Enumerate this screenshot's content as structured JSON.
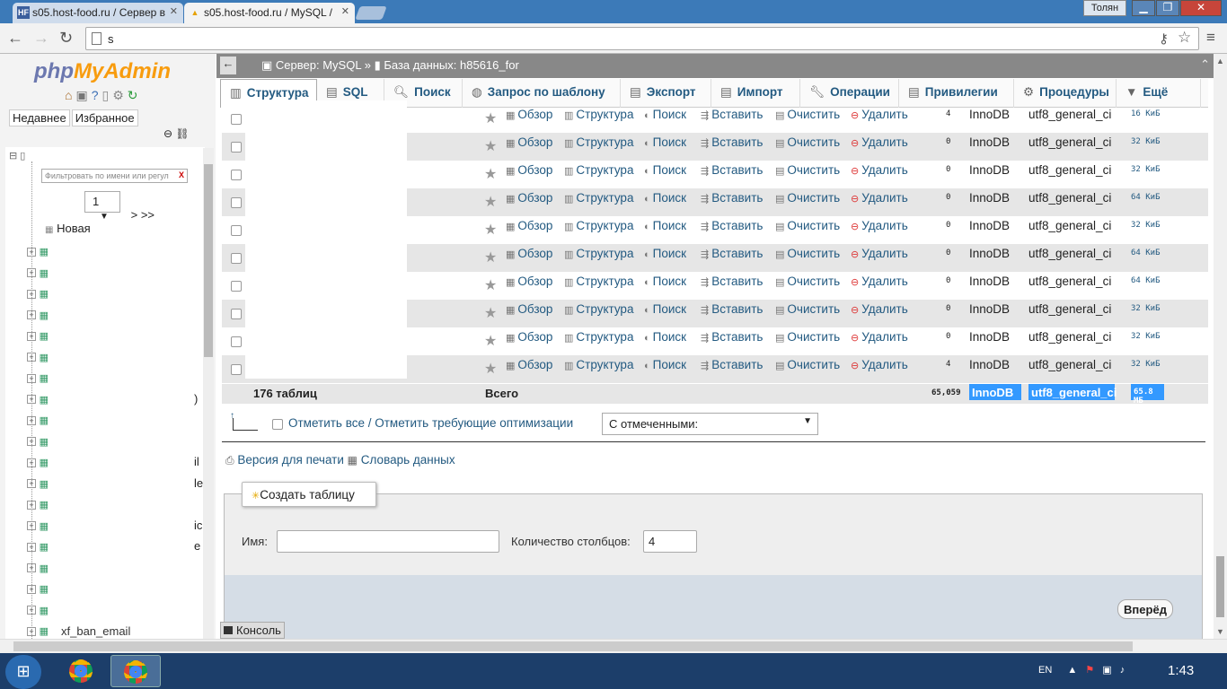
{
  "browser": {
    "tabs": [
      {
        "favicon": "HF",
        "title": "s05.host-food.ru / Сервер в"
      },
      {
        "favicon": "PMA",
        "title": "s05.host-food.ru / MySQL / "
      }
    ],
    "window_user": "Толян",
    "url": "s"
  },
  "sidebar": {
    "logo_a": "php",
    "logo_b": "MyAdmin",
    "tabs": [
      "Недавнее",
      "Избранное"
    ],
    "filter_placeholder": "Фильтровать по имени или регул",
    "filter_clear": "X",
    "page_select": "1",
    "page_next": "> >>",
    "new_label": "Новая",
    "tree_row_count": 19,
    "tree_tail": "xf_ban_email",
    "fragments": [
      {
        "text": ")",
        "row": 7
      },
      {
        "text": "il",
        "row": 10
      },
      {
        "text": "le",
        "row": 11
      },
      {
        "text": "ic",
        "row": 13
      },
      {
        "text": "e",
        "row": 14
      }
    ]
  },
  "breadcrumb": {
    "server": "Сервер: MySQL",
    "sep": "»",
    "db": "База данных: h85616_for"
  },
  "tabs": [
    {
      "label": "Структура",
      "icon": "structure-icon",
      "active": true
    },
    {
      "label": "SQL",
      "icon": "sql-icon"
    },
    {
      "label": "Поиск",
      "icon": "search-icon"
    },
    {
      "label": "Запрос по шаблону",
      "icon": "query-icon"
    },
    {
      "label": "Экспорт",
      "icon": "export-icon"
    },
    {
      "label": "Импорт",
      "icon": "import-icon"
    },
    {
      "label": "Операции",
      "icon": "wrench-icon"
    },
    {
      "label": "Привилегии",
      "icon": "privileges-icon"
    },
    {
      "label": "Процедуры",
      "icon": "routines-icon"
    },
    {
      "label": "Ещё",
      "icon": "more-icon"
    }
  ],
  "row_actions": {
    "browse": "Обзор",
    "structure": "Структура",
    "search": "Поиск",
    "insert": "Вставить",
    "empty": "Очистить",
    "drop": "Удалить"
  },
  "table_rows": [
    {
      "records": "4",
      "engine": "InnoDB",
      "collation": "utf8_general_ci",
      "size": "16 КиБ"
    },
    {
      "records": "0",
      "engine": "InnoDB",
      "collation": "utf8_general_ci",
      "size": "32 КиБ"
    },
    {
      "records": "0",
      "engine": "InnoDB",
      "collation": "utf8_general_ci",
      "size": "32 КиБ"
    },
    {
      "records": "0",
      "engine": "InnoDB",
      "collation": "utf8_general_ci",
      "size": "64 КиБ"
    },
    {
      "records": "0",
      "engine": "InnoDB",
      "collation": "utf8_general_ci",
      "size": "32 КиБ"
    },
    {
      "records": "0",
      "engine": "InnoDB",
      "collation": "utf8_general_ci",
      "size": "64 КиБ"
    },
    {
      "records": "0",
      "engine": "InnoDB",
      "collation": "utf8_general_ci",
      "size": "64 КиБ"
    },
    {
      "records": "0",
      "engine": "InnoDB",
      "collation": "utf8_general_ci",
      "size": "32 КиБ"
    },
    {
      "records": "0",
      "engine": "InnoDB",
      "collation": "utf8_general_ci",
      "size": "32 КиБ"
    },
    {
      "records": "4",
      "engine": "InnoDB",
      "collation": "utf8_general_ci",
      "size": "32 КиБ"
    }
  ],
  "totals": {
    "tables": "176 таблиц",
    "label": "Всего",
    "records": "65,059",
    "engine": "InnoDB",
    "collation": "utf8_general_ci",
    "size": "65.8 МБ"
  },
  "check_all": "Отметить все / Отметить требующие оптимизации",
  "with_selected": "С отмеченными:",
  "print_view": "Версия для печати",
  "data_dictionary": "Словарь данных",
  "create_table": {
    "legend": "Создать таблицу",
    "name_label": "Имя:",
    "name_value": "",
    "cols_label": "Количество столбцов:",
    "cols_value": "4",
    "go": "Вперёд"
  },
  "console": "Консоль",
  "taskbar": {
    "lang": "EN",
    "clock": "1:43"
  },
  "colors": {
    "link": "#235a81",
    "selection": "#3399ff",
    "stripe": "#e6e6e6"
  }
}
